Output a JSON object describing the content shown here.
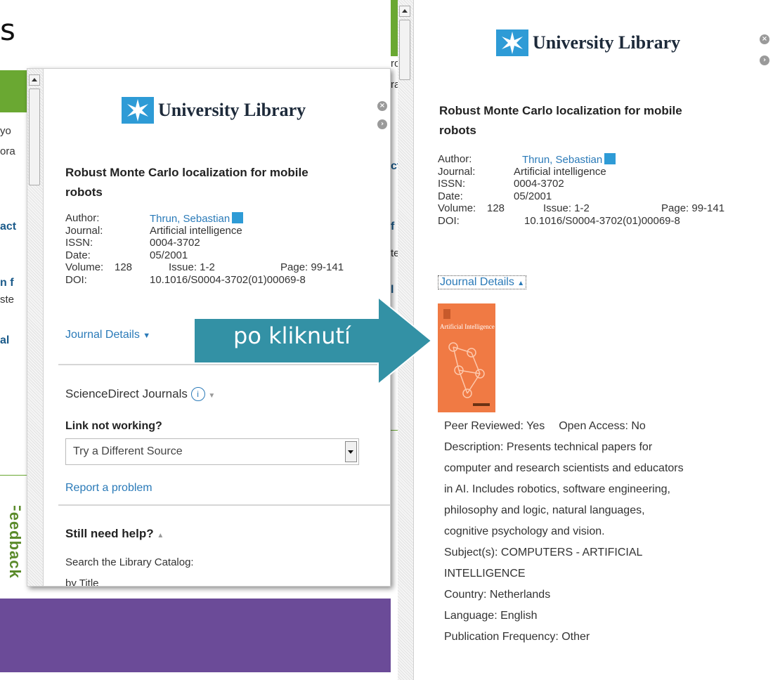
{
  "background": {
    "cut_letter": "s",
    "left_fragments": [
      "yo",
      "ora",
      "act",
      "n f",
      "ste",
      "al"
    ],
    "middle_fragments": [
      "ro",
      "ra",
      "ct",
      "f",
      "te",
      "l"
    ],
    "feedback": "Feedback"
  },
  "left_popup": {
    "logo_text": "University Library",
    "title_line1": "Robust Monte Carlo localization for mobile",
    "title_line2": "robots",
    "labels": {
      "author": "Author:",
      "journal": "Journal:",
      "issn": "ISSN:",
      "date": "Date:",
      "volume": "Volume:",
      "doi": "DOI:"
    },
    "author": "Thrun, Sebastian",
    "journal": "Artificial intelligence",
    "issn": "0004-3702",
    "date": "05/2001",
    "volume": "128",
    "issue": "Issue: 1-2",
    "page": "Page: 99-141",
    "doi": "10.1016/S0004-3702(01)00069-8",
    "journal_details": "Journal Details",
    "source_name": "ScienceDirect Journals",
    "link_not_working": "Link not working?",
    "select_value": "Try a Different Source",
    "report": "Report a problem",
    "still_help": "Still need help?",
    "search_catalog": "Search the Library Catalog:",
    "by_title": "by Title"
  },
  "arrow": {
    "label": "po kliknutí",
    "color": "#3391a5"
  },
  "right_popup": {
    "logo_text": "University Library",
    "title_line1": "Robust Monte Carlo localization for mobile",
    "title_line2": "robots",
    "labels": {
      "author": "Author:",
      "journal": "Journal:",
      "issn": "ISSN:",
      "date": "Date:",
      "volume": "Volume:",
      "doi": "DOI:"
    },
    "author": "Thrun, Sebastian",
    "journal": "Artificial intelligence",
    "issn": "0004-3702",
    "date": "05/2001",
    "volume": "128",
    "issue": "Issue: 1-2",
    "page": "Page: 99-141",
    "doi": "10.1016/S0004-3702(01)00069-8",
    "journal_details": "Journal Details",
    "cover_title": "Artificial Intelligence",
    "peer_reviewed": "Peer Reviewed: Yes",
    "open_access": "Open Access: No",
    "description": [
      "Description: Presents technical papers for",
      "computer and research scientists and educators",
      "in AI. Includes robotics, software engineering,",
      "philosophy and logic, natural languages,",
      "cognitive psychology and vision."
    ],
    "subjects": [
      "Subject(s): COMPUTERS - ARTIFICIAL",
      "INTELLIGENCE"
    ],
    "country": "Country: Netherlands",
    "language": "Language: English",
    "frequency": "Publication Frequency: Other"
  },
  "colors": {
    "brand": "#2e9bd6",
    "link": "#2a7ab8",
    "green": "#6aa832",
    "purple": "#6b4b98",
    "cover": "#f07a44"
  }
}
